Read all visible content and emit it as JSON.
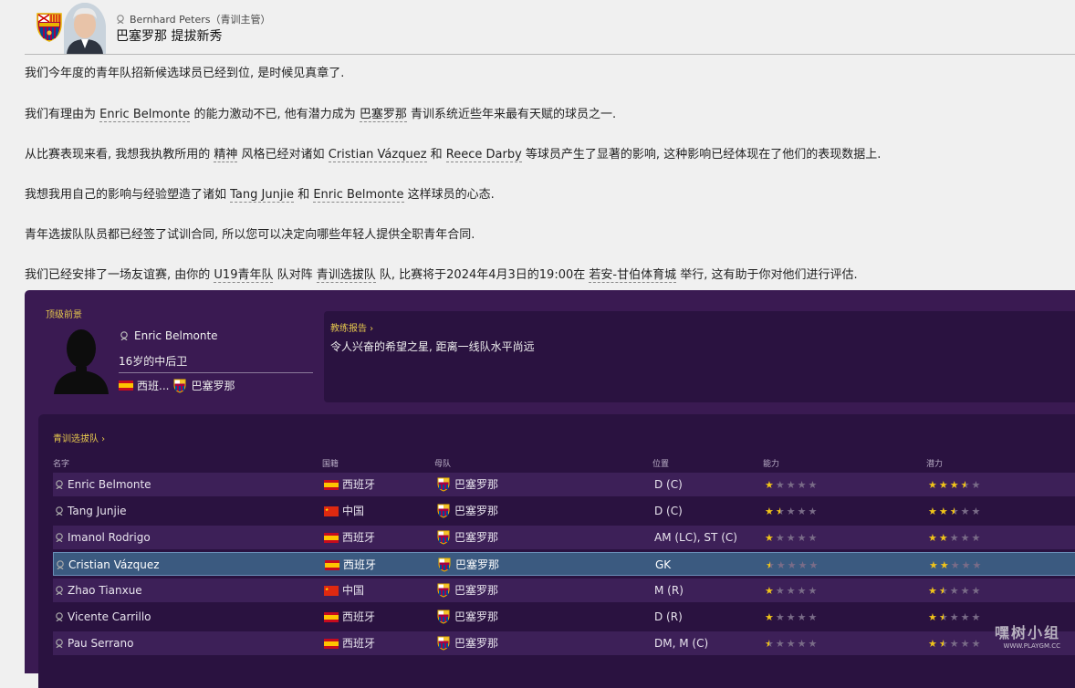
{
  "header": {
    "sender": "Bernhard Peters（青训主管）",
    "subject": "巴塞罗那 提拔新秀",
    "crest_icon": "fc-barcelona-crest-icon",
    "avatar_icon": "staff-photo"
  },
  "message": {
    "p1": "我们今年度的青年队招新候选球员已经到位, 是时候见真章了.",
    "p2": [
      "我们有理由为 ",
      "Enric Belmonte",
      " 的能力激动不已, 他有潜力成为 ",
      "巴塞罗那",
      " 青训系统近些年来最有天赋的球员之一."
    ],
    "p3": [
      "从比赛表现来看, 我想我执教所用的 ",
      "精神",
      " 风格已经对诸如 ",
      "Cristian Vázquez",
      " 和 ",
      "Reece Darby",
      " 等球员产生了显著的影响, 这种影响已经体现在了他们的表现数据上."
    ],
    "p4": [
      "我想我用自己的影响与经验塑造了诸如 ",
      "Tang Junjie",
      " 和 ",
      "Enric Belmonte",
      " 这样球员的心态."
    ],
    "p5": "青年选拔队队员都已经签了试训合同, 所以您可以决定向哪些年轻人提供全职青年合同.",
    "p6": [
      "我们已经安排了一场友谊赛, 由你的 ",
      "U19青年队",
      " 队对阵 ",
      "青训选拔队",
      " 队, 比赛将于2024年4月3日的19:00在 ",
      "若安-甘伯体育城",
      " 举行, 这有助于你对他们进行评估."
    ]
  },
  "top_prospect": {
    "section_title": "顶级前景",
    "name": "Enric Belmonte",
    "description": "16岁的中后卫",
    "nationality": "西班...",
    "club": "巴塞罗那"
  },
  "coach_report": {
    "title": "教练报告 ›",
    "text": "令人兴奋的希望之星, 距离一线队水平尚远"
  },
  "squad": {
    "title": "青训选拔队 ›",
    "columns": {
      "name": "名字",
      "nationality": "国籍",
      "parent_club": "母队",
      "position": "位置",
      "ability": "能力",
      "potential": "潜力"
    },
    "rows": [
      {
        "name": "Enric Belmonte",
        "nat": "西班牙",
        "flag": "spain",
        "club": "巴塞罗那",
        "pos": "D (C)",
        "ability": 1.0,
        "potential": 3.5
      },
      {
        "name": "Tang Junjie",
        "nat": "中国",
        "flag": "china",
        "club": "巴塞罗那",
        "pos": "D (C)",
        "ability": 1.5,
        "potential": 2.5
      },
      {
        "name": "Imanol Rodrigo",
        "nat": "西班牙",
        "flag": "spain",
        "club": "巴塞罗那",
        "pos": "AM (LC), ST (C)",
        "ability": 1.0,
        "potential": 2.0
      },
      {
        "name": "Cristian Vázquez",
        "nat": "西班牙",
        "flag": "spain",
        "club": "巴塞罗那",
        "pos": "GK",
        "ability": 0.5,
        "potential": 2.0
      },
      {
        "name": "Zhao Tianxue",
        "nat": "中国",
        "flag": "china",
        "club": "巴塞罗那",
        "pos": "M (R)",
        "ability": 1.0,
        "potential": 1.5
      },
      {
        "name": "Vicente Carrillo",
        "nat": "西班牙",
        "flag": "spain",
        "club": "巴塞罗那",
        "pos": "D (R)",
        "ability": 1.0,
        "potential": 1.5
      },
      {
        "name": "Pau Serrano",
        "nat": "西班牙",
        "flag": "spain",
        "club": "巴塞罗那",
        "pos": "DM, M (C)",
        "ability": 0.5,
        "potential": 1.5
      }
    ],
    "selected_index": 3
  },
  "watermark": {
    "text": "嘿树小组",
    "sub": "WWW.PLAYGM.CC"
  },
  "colors": {
    "accent_gold": "#e6c84d",
    "panel": "#3a1a52",
    "panel_dark": "#2a1240",
    "star": "#f0c419",
    "selected_row": "#3b5a80"
  }
}
